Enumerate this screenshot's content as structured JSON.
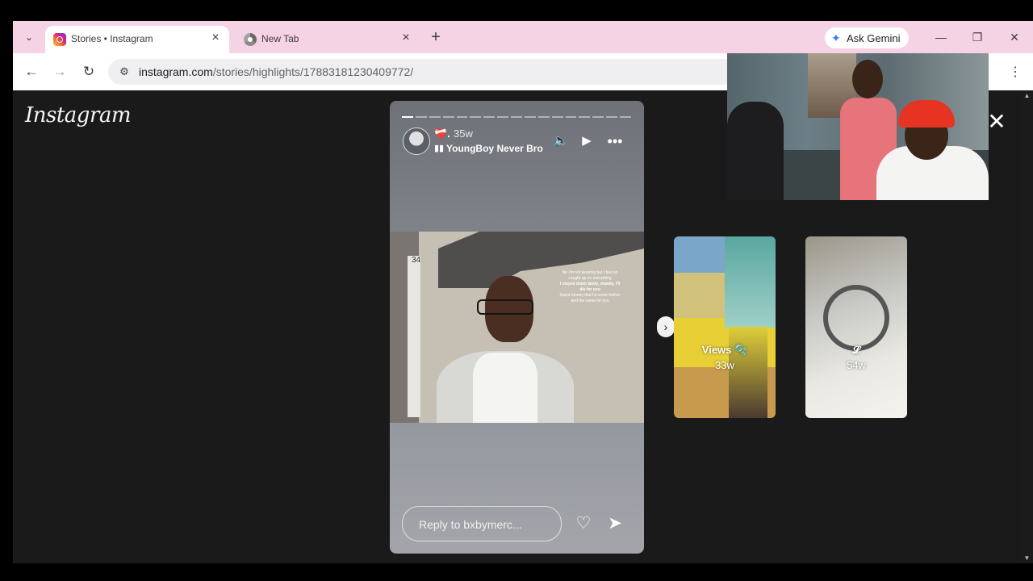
{
  "browser": {
    "tabs": [
      {
        "title": "Stories • Instagram",
        "icon": "instagram-icon",
        "active": true
      },
      {
        "title": "New Tab",
        "icon": "chrome-icon",
        "active": false
      }
    ],
    "new_tab_label": "+",
    "gemini_label": "Ask Gemini",
    "url_host": "instagram.com",
    "url_path": "/stories/highlights/17883181230409772/"
  },
  "page": {
    "logo": "Instagram",
    "story": {
      "username": "❤️‍🩹.",
      "time": "35w",
      "music_title": "YoungBoy Never Broke Again",
      "overlay_text_lines": [
        "No I'm not wearing but I feel so",
        "caught up on everything",
        "I stayed down lately, shawty, I'll",
        "die for you",
        "Spent money that I'd never bother",
        "and the same for you"
      ],
      "door_number": "34",
      "reply_placeholder": "Reply to bxbymerc...",
      "segments_total": 17,
      "segments_done": 1
    },
    "highlights": [
      {
        "title": "Views 🫧",
        "time": "33w"
      },
      {
        "title": "𝓛",
        "time": "54w"
      }
    ]
  },
  "colors": {
    "tabstrip_bg": "#f6d3e4",
    "page_bg": "#1a1a1a",
    "accent": "#3a7cf2"
  }
}
